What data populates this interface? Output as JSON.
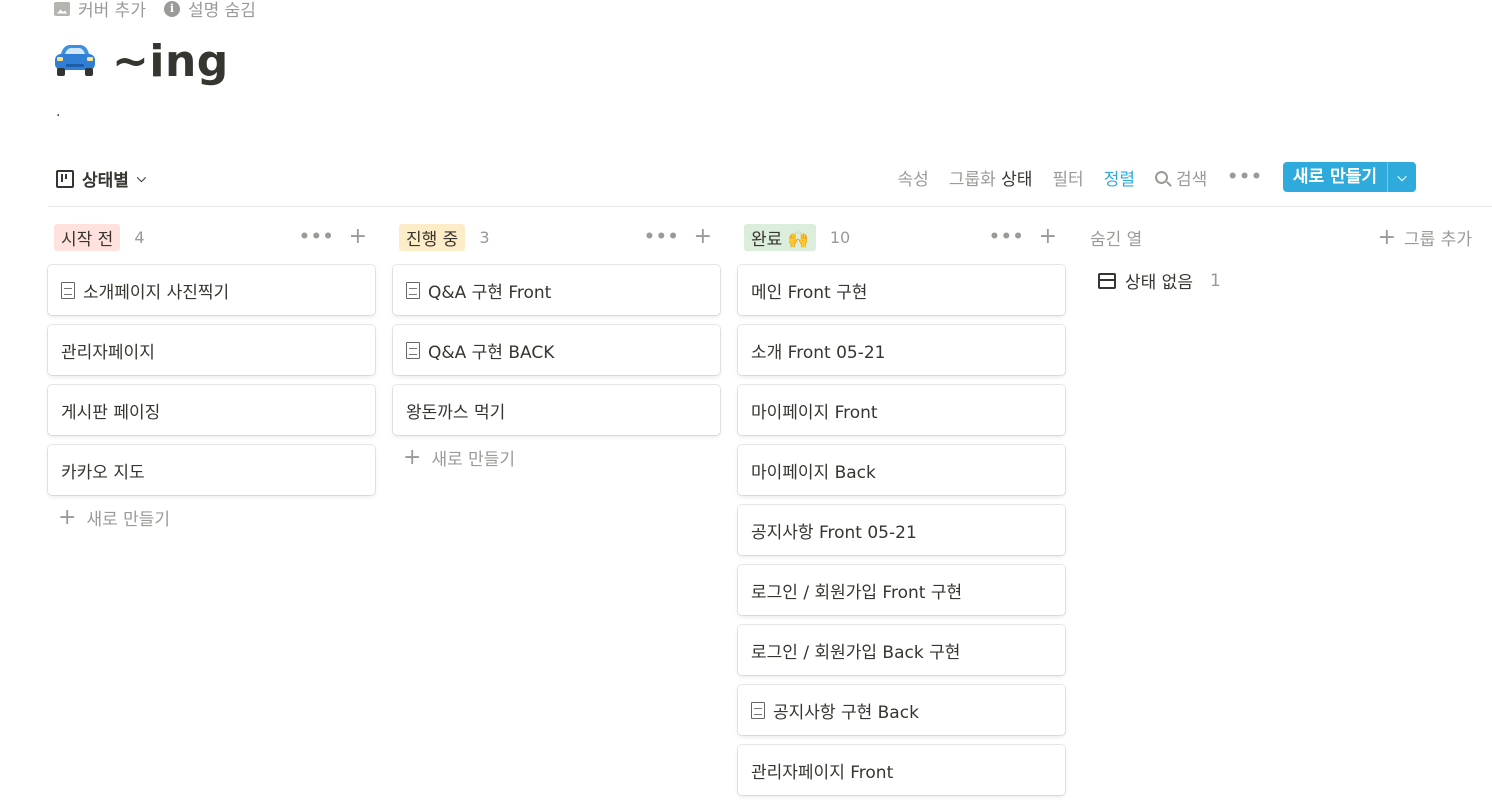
{
  "top_actions": {
    "add_cover": "커버 추가",
    "hide_description": "설명 숨김"
  },
  "page": {
    "icon": "car-icon",
    "title": "~ing",
    "description": "."
  },
  "view": {
    "name": "상태별"
  },
  "toolbar": {
    "properties": "속성",
    "group_prefix": "그룹화",
    "group_value": "상태",
    "filter": "필터",
    "sort": "정렬",
    "search": "검색",
    "more": "•••",
    "new_button": "새로 만들기"
  },
  "columns": [
    {
      "label": "시작 전",
      "count": "4",
      "tag_color": "#ffe2dd",
      "cards": [
        {
          "title": "소개페이지 사진찍기",
          "doc_icon": true
        },
        {
          "title": "관리자페이지",
          "doc_icon": false
        },
        {
          "title": "게시판 페이징",
          "doc_icon": false
        },
        {
          "title": "카카오 지도",
          "doc_icon": false
        }
      ],
      "new_label": "새로 만들기"
    },
    {
      "label": "진행 중",
      "count": "3",
      "tag_color": "#fdecc8",
      "cards": [
        {
          "title": "Q&A 구현 Front",
          "doc_icon": true
        },
        {
          "title": "Q&A 구현 BACK",
          "doc_icon": true
        },
        {
          "title": "왕돈까스 먹기",
          "doc_icon": false
        }
      ],
      "new_label": "새로 만들기"
    },
    {
      "label": "완료 🙌",
      "count": "10",
      "tag_color": "#dbeddb",
      "cards": [
        {
          "title": "메인 Front 구현",
          "doc_icon": false
        },
        {
          "title": "소개 Front 05-21",
          "doc_icon": false
        },
        {
          "title": "마이페이지 Front",
          "doc_icon": false
        },
        {
          "title": "마이페이지 Back",
          "doc_icon": false
        },
        {
          "title": "공지사항 Front 05-21",
          "doc_icon": false
        },
        {
          "title": "로그인 / 회원가입 Front 구현",
          "doc_icon": false
        },
        {
          "title": "로그인 / 회원가입 Back 구현",
          "doc_icon": false
        },
        {
          "title": "공지사항 구현 Back",
          "doc_icon": true
        },
        {
          "title": "관리자페이지 Front",
          "doc_icon": false
        }
      ],
      "new_label": ""
    }
  ],
  "hidden": {
    "title": "숨긴 열",
    "add_group": "그룹 추가",
    "items": [
      {
        "label": "상태 없음",
        "count": "1"
      }
    ]
  }
}
